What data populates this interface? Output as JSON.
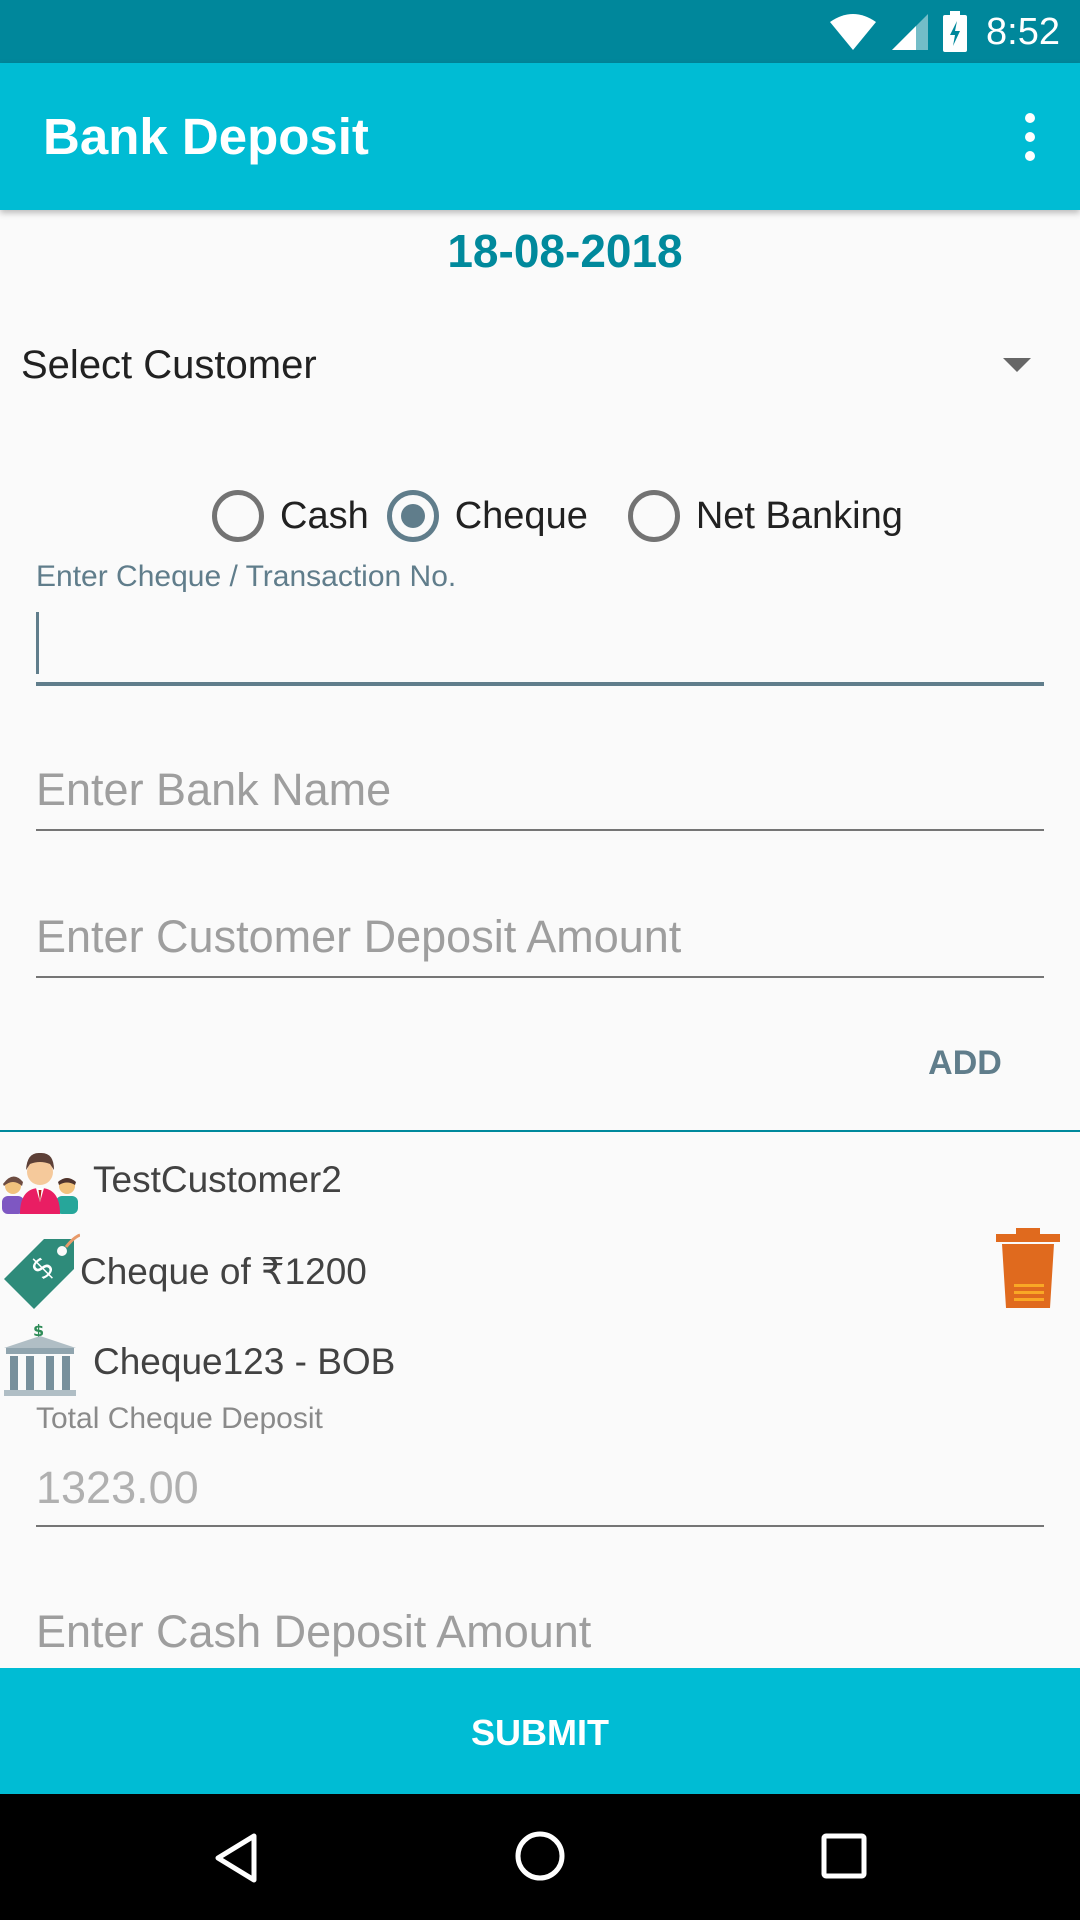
{
  "status_bar": {
    "time": "8:52"
  },
  "app_bar": {
    "title": "Bank Deposit",
    "menu_icon": "more-vert-icon"
  },
  "date": "18-08-2018",
  "customer_select": {
    "selected": "Select Customer"
  },
  "payment_modes": [
    {
      "label": "Cash",
      "checked": false
    },
    {
      "label": "Cheque",
      "checked": true
    },
    {
      "label": "Net Banking",
      "checked": false
    }
  ],
  "form": {
    "transaction_label": "Enter Cheque / Transaction No.",
    "transaction_value": "",
    "bank_placeholder": "Enter Bank Name",
    "amount_placeholder": "Enter Customer Deposit Amount",
    "add_label": "ADD"
  },
  "entry": {
    "customer": "TestCustomer2",
    "payment": "Cheque of ₹1200",
    "bank": "Cheque123 - BOB"
  },
  "totals": {
    "cheque_label": "Total Cheque Deposit",
    "cheque_value": "1323.00",
    "cash_placeholder": "Enter Cash Deposit Amount"
  },
  "submit_label": "SUBMIT",
  "colors": {
    "primary": "#00bcd4",
    "primary_dark": "#00879b",
    "accent": "#607d8b",
    "trash": "#e06a1e"
  }
}
